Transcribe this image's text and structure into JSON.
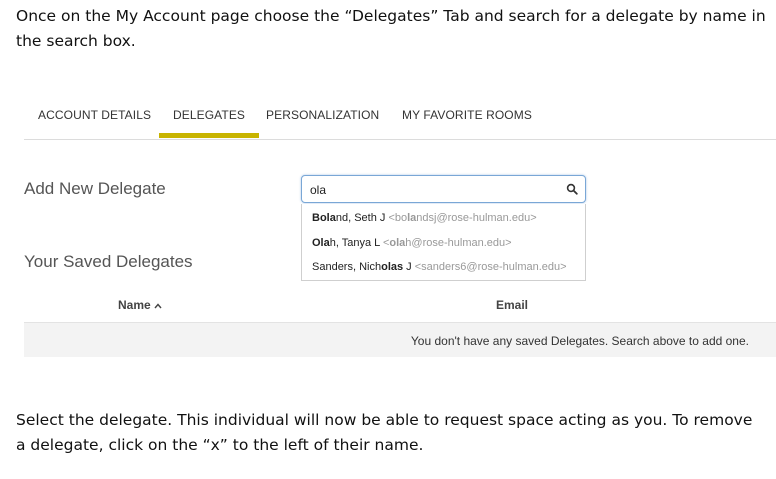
{
  "instructions": {
    "intro": "Once on the My Account page choose the “Delegates” Tab and search for a delegate by name in the search box.",
    "outro": "Select the delegate.  This individual will now be able to request space acting as you.  To remove a delegate, click on the “x” to the left of their name."
  },
  "tabs": [
    {
      "label": "ACCOUNT DETAILS"
    },
    {
      "label": "DELEGATES",
      "active": true
    },
    {
      "label": "PERSONALIZATION"
    },
    {
      "label": "MY FAVORITE ROOMS"
    }
  ],
  "add_delegate": {
    "title": "Add New Delegate",
    "search_value": "ola",
    "suggestions": [
      {
        "name_pre": "",
        "name_match": "Bola",
        "name_post": "nd, Seth J ",
        "email_pre": "<bo",
        "email_match": "la",
        "email_post": "ndsj@rose-hulman.edu>"
      },
      {
        "name_pre": "",
        "name_match": "Ola",
        "name_post": "h, Tanya L ",
        "email_pre": "<",
        "email_match": "ola",
        "email_post": "h@rose-hulman.edu>"
      },
      {
        "name_pre": "Sanders, Nich",
        "name_match": "olas",
        "name_post": " J ",
        "email_pre": "<sanders6@rose-hulman.edu>",
        "email_match": "",
        "email_post": ""
      }
    ]
  },
  "saved_delegates": {
    "title": "Your Saved Delegates",
    "columns": {
      "name": "Name",
      "email": "Email"
    },
    "empty_message": "You don't have any saved Delegates. Search above to add one."
  },
  "colors": {
    "active_tab_underline": "#c8b400",
    "search_border": "#7aa7d6"
  },
  "icons": {
    "search": "search-icon",
    "sort": "sort-ascending-icon"
  }
}
